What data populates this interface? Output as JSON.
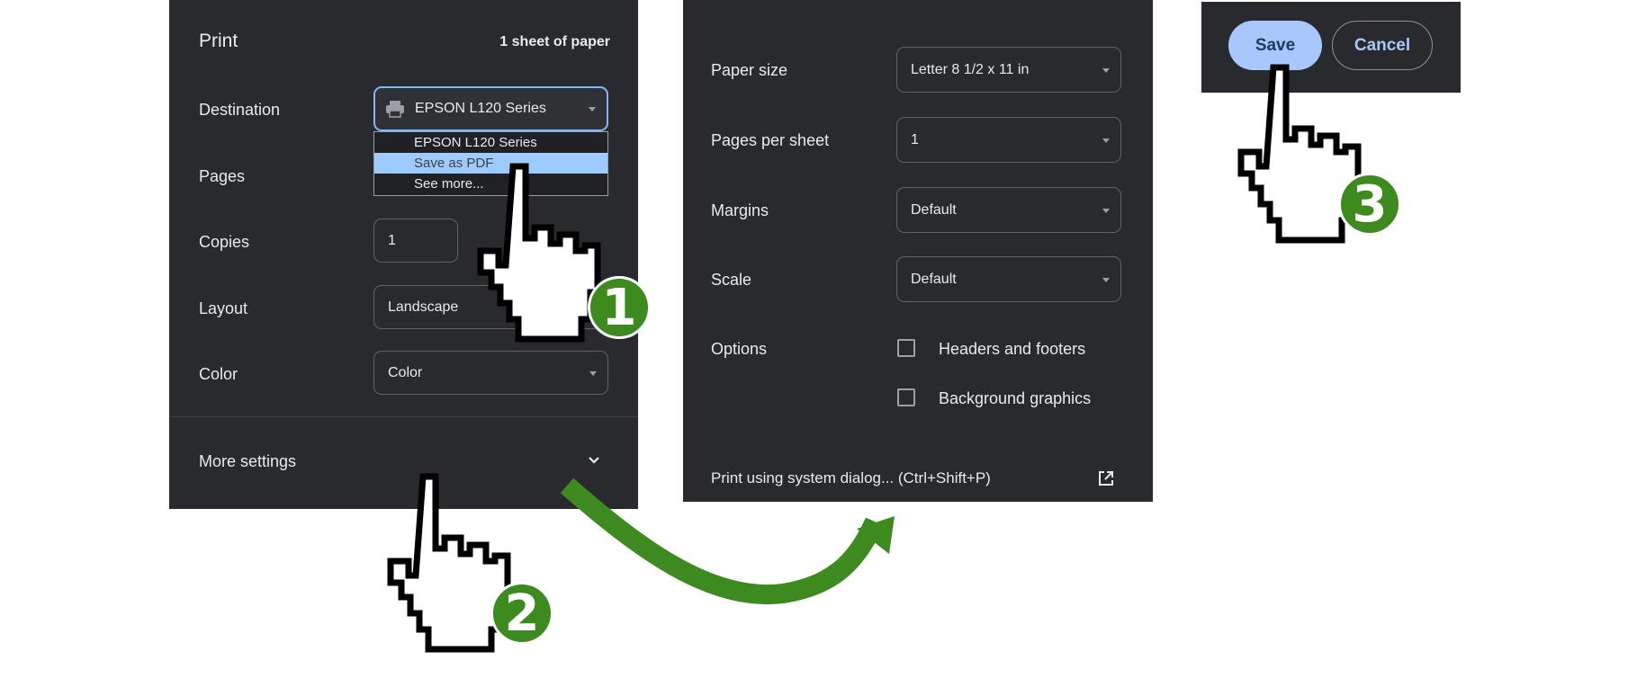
{
  "print_panel": {
    "title": "Print",
    "sheet_count": "1 sheet of paper",
    "destination_label": "Destination",
    "destination_value": "EPSON L120 Series",
    "destination_options": [
      "EPSON L120 Series",
      "Save as PDF",
      "See more..."
    ],
    "pages_label": "Pages",
    "copies_label": "Copies",
    "copies_value": "1",
    "layout_label": "Layout",
    "layout_value": "Landscape",
    "color_label": "Color",
    "color_value": "Color",
    "more_settings_label": "More settings"
  },
  "more_settings_panel": {
    "paper_size_label": "Paper size",
    "paper_size_value": "Letter 8 1/2 x 11 in",
    "pages_per_sheet_label": "Pages per sheet",
    "pages_per_sheet_value": "1",
    "margins_label": "Margins",
    "margins_value": "Default",
    "scale_label": "Scale",
    "scale_value": "Default",
    "options_label": "Options",
    "headers_footers_label": "Headers and footers",
    "background_graphics_label": "Background graphics",
    "system_dialog_label": "Print using system dialog... (Ctrl+Shift+P)"
  },
  "action_panel": {
    "save_label": "Save",
    "cancel_label": "Cancel"
  },
  "steps": [
    "1",
    "2",
    "3"
  ],
  "colors": {
    "panel_bg": "#292a2d",
    "accent_blue": "#a8c7fa",
    "step_green": "#3d8b1f",
    "selected_option": "#9ecbff"
  }
}
